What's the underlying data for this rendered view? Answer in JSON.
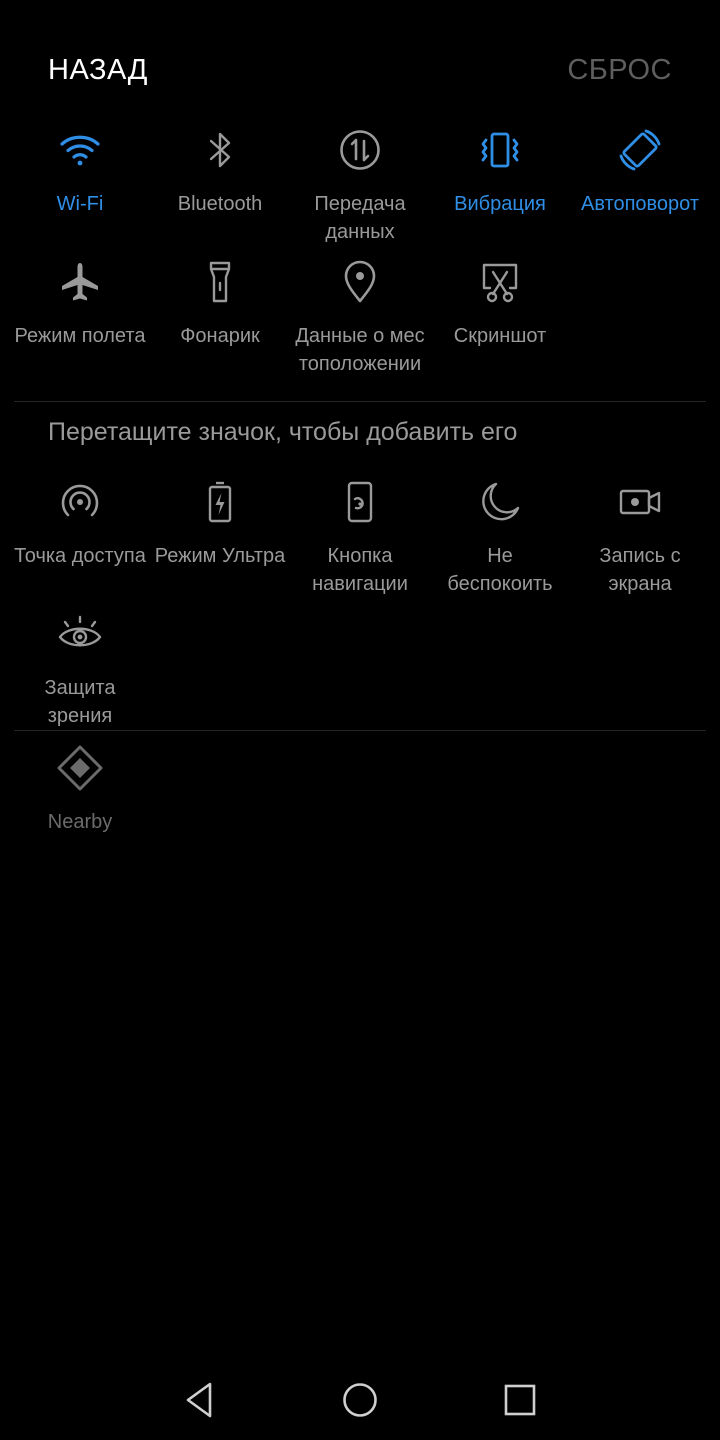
{
  "header": {
    "back_label": "НАЗАД",
    "reset_label": "СБРОС"
  },
  "colors": {
    "background": "#000000",
    "active_accent": "#2f8fe6",
    "inactive_icon": "#9a9a9a",
    "disabled_text": "#5e5e5e"
  },
  "active_tiles": [
    {
      "label": "Wi-Fi",
      "icon": "wifi-icon",
      "state": "on"
    },
    {
      "label": "Bluetooth",
      "icon": "bluetooth-icon",
      "state": "off"
    },
    {
      "label": "Передача\nданных",
      "icon": "mobile-data-icon",
      "state": "off"
    },
    {
      "label": "Вибрация",
      "icon": "vibration-icon",
      "state": "on"
    },
    {
      "label": "Автоповорот",
      "icon": "auto-rotate-icon",
      "state": "on"
    },
    {
      "label": "Режим полета",
      "icon": "airplane-icon",
      "state": "off"
    },
    {
      "label": "Фонарик",
      "icon": "flashlight-icon",
      "state": "off"
    },
    {
      "label": "Данные о мес\nтоположении",
      "icon": "location-icon",
      "state": "off"
    },
    {
      "label": "Скриншот",
      "icon": "screenshot-icon",
      "state": "off"
    }
  ],
  "hint_text": "Перетащите значок, чтобы добавить его",
  "available_tiles": [
    {
      "label": "Точка доступа",
      "icon": "hotspot-icon"
    },
    {
      "label": "Режим Ультра",
      "icon": "battery-ultra-icon"
    },
    {
      "label": "Кнопка\nнавигации",
      "icon": "nav-button-icon"
    },
    {
      "label": "Не\nбеспокоить",
      "icon": "moon-icon"
    },
    {
      "label": "Запись с\nэкрана",
      "icon": "screen-record-icon"
    },
    {
      "label": "Защита\nзрения",
      "icon": "eye-icon"
    }
  ],
  "extra_tiles": [
    {
      "label": "Nearby",
      "icon": "nearby-icon"
    }
  ],
  "navbar": {
    "back": "back-icon",
    "home": "home-icon",
    "recents": "recents-icon"
  }
}
